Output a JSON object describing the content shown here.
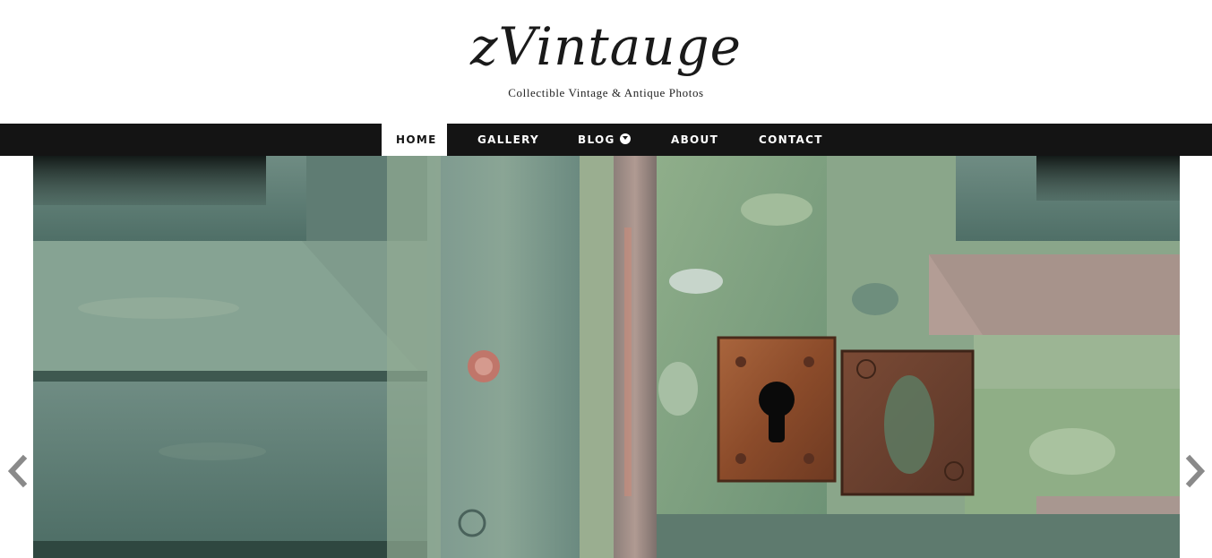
{
  "site": {
    "logo": "zVintauge",
    "tagline": "Collectible Vintage & Antique Photos"
  },
  "nav": {
    "items": [
      {
        "label": "HOME",
        "active": true
      },
      {
        "label": "GALLERY",
        "active": false
      },
      {
        "label": "BLOG",
        "active": false,
        "has_dropdown": true
      },
      {
        "label": "ABOUT",
        "active": false
      },
      {
        "label": "CONTACT",
        "active": false
      }
    ],
    "dropdown_icon": "chevron-down-circle-icon"
  },
  "slider": {
    "image_subject": "weathered green painted door with rusty keyhole plate",
    "prev_icon": "chevron-left-icon",
    "next_icon": "chevron-right-icon"
  },
  "colors": {
    "nav_background": "#141414",
    "nav_text": "#ffffff",
    "active_item_background": "#ffffff",
    "active_item_text": "#141414",
    "arrow_color": "#8a8a8a"
  }
}
